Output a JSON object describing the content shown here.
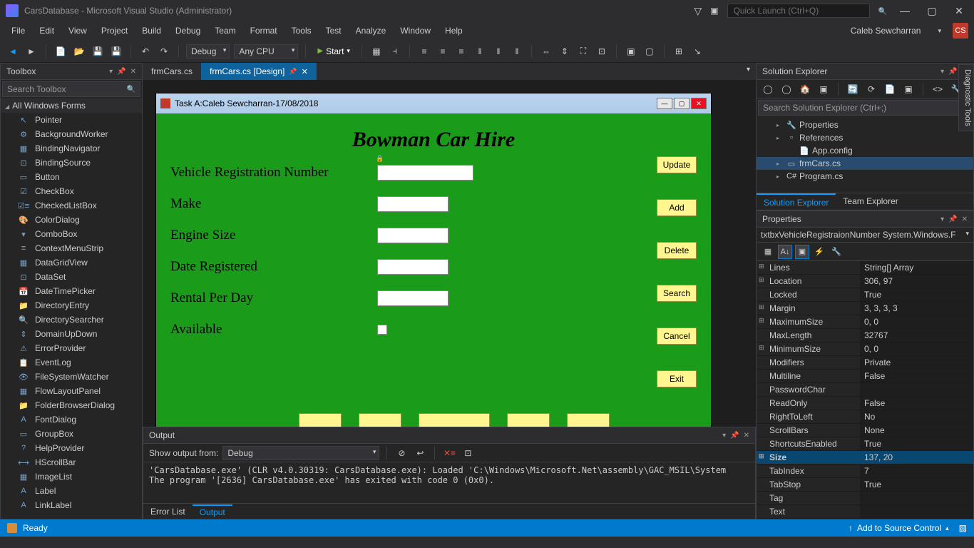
{
  "title": "CarsDatabase - Microsoft Visual Studio  (Administrator)",
  "quick_launch_placeholder": "Quick Launch (Ctrl+Q)",
  "user_name": "Caleb Sewcharran",
  "user_initials": "CS",
  "menu": [
    "File",
    "Edit",
    "View",
    "Project",
    "Build",
    "Debug",
    "Team",
    "Format",
    "Tools",
    "Test",
    "Analyze",
    "Window",
    "Help"
  ],
  "toolbar": {
    "config": "Debug",
    "platform": "Any CPU",
    "start": "Start"
  },
  "toolbox": {
    "title": "Toolbox",
    "search_placeholder": "Search Toolbox",
    "category": "All Windows Forms",
    "items": [
      "Pointer",
      "BackgroundWorker",
      "BindingNavigator",
      "BindingSource",
      "Button",
      "CheckBox",
      "CheckedListBox",
      "ColorDialog",
      "ComboBox",
      "ContextMenuStrip",
      "DataGridView",
      "DataSet",
      "DateTimePicker",
      "DirectoryEntry",
      "DirectorySearcher",
      "DomainUpDown",
      "ErrorProvider",
      "EventLog",
      "FileSystemWatcher",
      "FlowLayoutPanel",
      "FolderBrowserDialog",
      "FontDialog",
      "GroupBox",
      "HelpProvider",
      "HScrollBar",
      "ImageList",
      "Label",
      "LinkLabel"
    ]
  },
  "tabs": [
    {
      "label": "frmCars.cs",
      "active": false
    },
    {
      "label": "frmCars.cs [Design]",
      "active": true
    }
  ],
  "form": {
    "title": "Task A:Caleb Sewcharran-17/08/2018",
    "heading": "Bowman Car Hire",
    "labels": [
      "Vehicle Registration Number",
      "Make",
      "Engine Size",
      "Date Registered",
      "Rental Per Day",
      "Available"
    ],
    "buttons": [
      "Update",
      "Add",
      "Delete",
      "Search",
      "Cancel",
      "Exit"
    ]
  },
  "output": {
    "title": "Output",
    "show_label": "Show output from:",
    "show_value": "Debug",
    "text": "'CarsDatabase.exe' (CLR v4.0.30319: CarsDatabase.exe): Loaded 'C:\\Windows\\Microsoft.Net\\assembly\\GAC_MSIL\\System\nThe program '[2636] CarsDatabase.exe' has exited with code 0 (0x0).",
    "tabs": [
      "Error List",
      "Output"
    ]
  },
  "solution": {
    "title": "Solution Explorer",
    "search_placeholder": "Search Solution Explorer (Ctrl+;)",
    "items": [
      {
        "label": "Properties",
        "level": 1,
        "arrow": "▸",
        "icon": "🔧"
      },
      {
        "label": "References",
        "level": 1,
        "arrow": "▸",
        "icon": "▫"
      },
      {
        "label": "App.config",
        "level": 2,
        "arrow": "",
        "icon": "📄"
      },
      {
        "label": "frmCars.cs",
        "level": 1,
        "arrow": "▸",
        "icon": "▭",
        "selected": true
      },
      {
        "label": "Program.cs",
        "level": 1,
        "arrow": "▸",
        "icon": "C#"
      }
    ],
    "tabs": [
      "Solution Explorer",
      "Team Explorer"
    ]
  },
  "properties": {
    "title": "Properties",
    "object": "txtbxVehicleRegistraionNumber System.Windows.F",
    "rows": [
      {
        "name": "Lines",
        "val": "String[] Array",
        "exp": "⊞"
      },
      {
        "name": "Location",
        "val": "306, 97",
        "exp": "⊞"
      },
      {
        "name": "Locked",
        "val": "True"
      },
      {
        "name": "Margin",
        "val": "3, 3, 3, 3",
        "exp": "⊞"
      },
      {
        "name": "MaximumSize",
        "val": "0, 0",
        "exp": "⊞"
      },
      {
        "name": "MaxLength",
        "val": "32767"
      },
      {
        "name": "MinimumSize",
        "val": "0, 0",
        "exp": "⊞"
      },
      {
        "name": "Modifiers",
        "val": "Private"
      },
      {
        "name": "Multiline",
        "val": "False"
      },
      {
        "name": "PasswordChar",
        "val": ""
      },
      {
        "name": "ReadOnly",
        "val": "False"
      },
      {
        "name": "RightToLeft",
        "val": "No"
      },
      {
        "name": "ScrollBars",
        "val": "None"
      },
      {
        "name": "ShortcutsEnabled",
        "val": "True"
      },
      {
        "name": "Size",
        "val": "137, 20",
        "exp": "⊞",
        "selected": true,
        "bold": true
      },
      {
        "name": "TabIndex",
        "val": "7"
      },
      {
        "name": "TabStop",
        "val": "True"
      },
      {
        "name": "Tag",
        "val": ""
      },
      {
        "name": "Text",
        "val": ""
      }
    ]
  },
  "status": {
    "ready": "Ready",
    "source_control": "Add to Source Control"
  },
  "side_tab": "Diagnostic Tools"
}
